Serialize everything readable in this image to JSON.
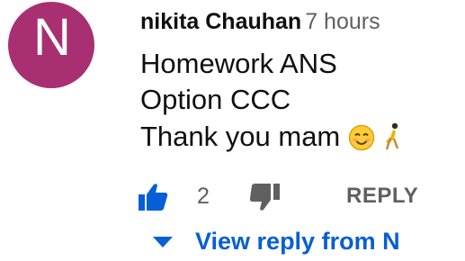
{
  "comment": {
    "avatar_letter": "N",
    "author": "nikita Chauhan",
    "time": "7 hours",
    "lines": [
      "Homework ANS",
      "Option CCC",
      "Thank you mam"
    ],
    "emojis": [
      "smiling-face",
      "dancer"
    ]
  },
  "actions": {
    "like_count": "2",
    "reply_label": "REPLY"
  },
  "replies": {
    "view_label": "View reply from N"
  },
  "colors": {
    "avatar": "#a82f72",
    "like_active": "#065fd4",
    "muted": "#606060",
    "link": "#065fd4"
  }
}
